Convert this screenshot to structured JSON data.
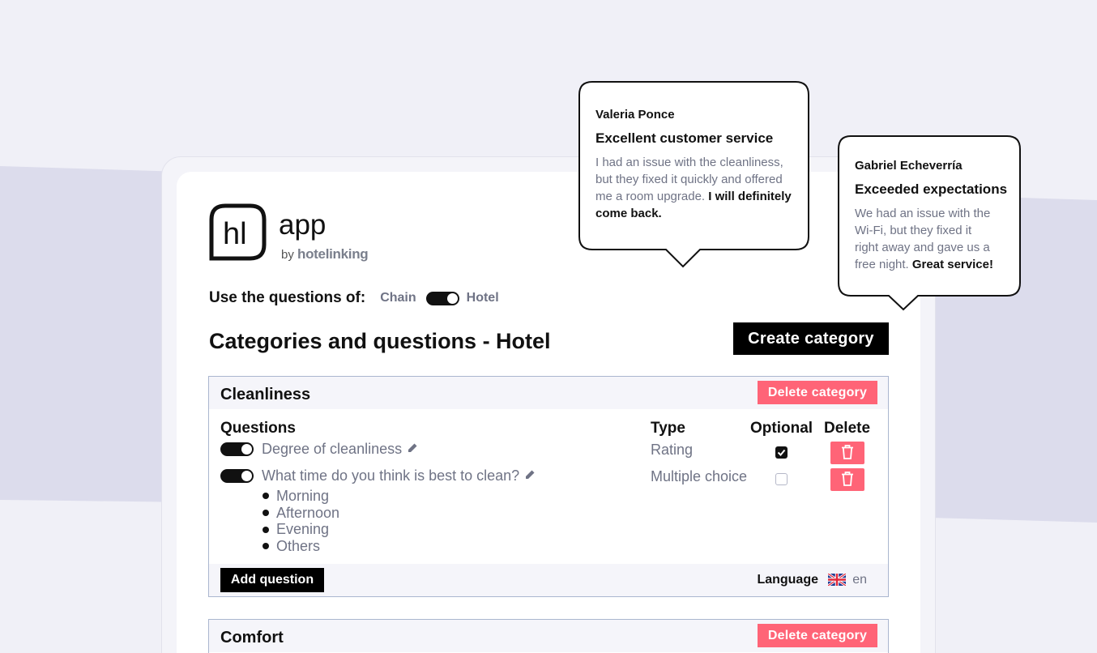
{
  "app": {
    "logo_mark": "hl",
    "title": "app",
    "by": "by",
    "brand": "hotelinking"
  },
  "source_toggle": {
    "label": "Use the questions of:",
    "option_left": "Chain",
    "option_right": "Hotel",
    "selected": "Hotel"
  },
  "page": {
    "title": "Categories and questions - Hotel",
    "create_button": "Create category"
  },
  "columns": {
    "questions": "Questions",
    "type": "Type",
    "optional": "Optional",
    "delete": "Delete"
  },
  "categories": [
    {
      "title": "Cleanliness",
      "delete_label": "Delete category",
      "questions": [
        {
          "text": "Degree of cleanliness",
          "type": "Rating",
          "enabled": true,
          "optional": true
        },
        {
          "text": "What time do you think is best to clean?",
          "type": "Multiple choice",
          "enabled": true,
          "optional": false,
          "options": [
            "Morning",
            "Afternoon",
            "Evening",
            "Others"
          ]
        }
      ],
      "add_question": "Add question",
      "language_label": "Language",
      "language_code": "en"
    },
    {
      "title": "Comfort",
      "delete_label": "Delete category"
    }
  ],
  "reviews": [
    {
      "name": "Valeria Ponce",
      "title": "Excellent customer service",
      "body_lines": [
        "I had an issue with the cleanliness,",
        "but they fixed it quickly and offered",
        "me a room upgrade."
      ],
      "emphasis_inline": "I will definitely",
      "emphasis_tail": "come back."
    },
    {
      "name": "Gabriel Echeverría",
      "title": "Exceeded expectations",
      "body_lines": [
        "We had an issue with the",
        "Wi-Fi, but they fixed it",
        "right away and gave us a",
        "free night."
      ],
      "emphasis": "Great service!"
    }
  ],
  "colors": {
    "background": "#f0f0f7",
    "band": "#dcdcec",
    "danger": "#ff6477",
    "muted_text": "#6f7385",
    "border": "#aab6cf"
  },
  "icons": [
    "pencil-icon",
    "trash-icon",
    "uk-flag-icon",
    "logo-icon"
  ]
}
